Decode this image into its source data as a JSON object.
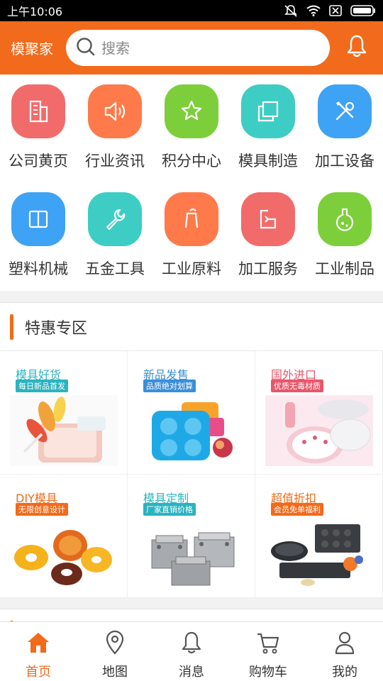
{
  "status_bar": {
    "time": "上午10:06",
    "icons": [
      "mute-icon",
      "wifi-icon",
      "no-sim-icon",
      "battery-icon"
    ]
  },
  "header": {
    "brand": "模聚家",
    "search_placeholder": "搜索",
    "bell_icon": "bell-icon"
  },
  "colors": {
    "accent": "#f26a1b"
  },
  "categories": [
    {
      "label": "公司黄页",
      "icon": "building-icon",
      "color": "#f26b6b"
    },
    {
      "label": "行业资讯",
      "icon": "speaker-icon",
      "color": "#ff7a4a"
    },
    {
      "label": "积分中心",
      "icon": "star-icon",
      "color": "#7ccf3a"
    },
    {
      "label": "模具制造",
      "icon": "copy-icon",
      "color": "#3dcdc4"
    },
    {
      "label": "加工设备",
      "icon": "tools-icon",
      "color": "#3ea2f5"
    },
    {
      "label": "塑料机械",
      "icon": "book-icon",
      "color": "#3ea2f5"
    },
    {
      "label": "五金工具",
      "icon": "wrench-icon",
      "color": "#3dcdc4"
    },
    {
      "label": "工业原料",
      "icon": "material-icon",
      "color": "#ff7a4a"
    },
    {
      "label": "加工服务",
      "icon": "service-icon",
      "color": "#f26b6b"
    },
    {
      "label": "工业制品",
      "icon": "flask-icon",
      "color": "#7ccf3a"
    }
  ],
  "special": {
    "title": "特惠专区",
    "promos": [
      {
        "title": "模具好货",
        "tag": "每日新品首发",
        "title_color": "#2bb3c0",
        "tag_color": "#2bb3c0",
        "image": "popsicle-mold-image"
      },
      {
        "title": "新品发售",
        "tag": "品质绝对划算",
        "title_color": "#3a8fd8",
        "tag_color": "#3a8fd8",
        "image": "ice-tray-image"
      },
      {
        "title": "国外进口",
        "tag": "优质无毒材质",
        "title_color": "#e9566b",
        "tag_color": "#e9566b",
        "image": "kitchenware-image"
      },
      {
        "title": "DIY模具",
        "tag": "无限创意设计",
        "title_color": "#f26a1b",
        "tag_color": "#f26a1b",
        "image": "donut-mold-image"
      },
      {
        "title": "模具定制",
        "tag": "厂家直销价格",
        "title_color": "#2bb3c0",
        "tag_color": "#2bb3c0",
        "image": "steel-mold-image"
      },
      {
        "title": "超值折扣",
        "tag": "会员免单福利",
        "title_color": "#f26a1b",
        "tag_color": "#f26a1b",
        "image": "baking-pan-image"
      }
    ]
  },
  "bottom_nav": [
    {
      "label": "首页",
      "icon": "home-icon",
      "active": true
    },
    {
      "label": "地图",
      "icon": "map-pin-icon",
      "active": false
    },
    {
      "label": "消息",
      "icon": "bell-icon",
      "active": false
    },
    {
      "label": "购物车",
      "icon": "cart-icon",
      "active": false
    },
    {
      "label": "我的",
      "icon": "user-icon",
      "active": false
    }
  ]
}
